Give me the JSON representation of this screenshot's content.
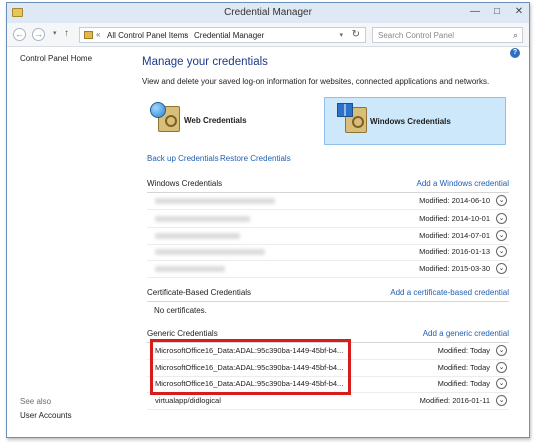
{
  "window": {
    "title": "Credential Manager",
    "controls": [
      "—",
      "□",
      "✕"
    ]
  },
  "nav": {
    "back_glyph": "←",
    "forward_glyph": "→",
    "dropdown_glyph": "▾",
    "up_glyph": "↑",
    "breadcrumb_arrows": "«",
    "breadcrumb": [
      "All Control Panel Items",
      "Credential Manager"
    ],
    "breadcrumb_sep": "›",
    "refresh_glyph": "↻",
    "search_placeholder": "Search Control Panel",
    "search_icon_glyph": "⌕"
  },
  "help_glyph": "?",
  "sidebar": {
    "home": "Control Panel Home",
    "see_also_label": "See also",
    "see_also_links": [
      "User Accounts"
    ]
  },
  "main": {
    "title": "Manage your credentials",
    "subtitle": "View and delete your saved log-on information for websites, connected applications and networks.",
    "tabs": [
      {
        "label": "Web Credentials",
        "selected": false
      },
      {
        "label": "Windows Credentials",
        "selected": true
      }
    ],
    "backup": "Back up Credentials",
    "restore": "Restore Credentials"
  },
  "windows_credentials": {
    "title": "Windows Credentials",
    "add": "Add a Windows credential",
    "rows": [
      {
        "name": "",
        "modified": "Modified:  2014-06-10"
      },
      {
        "name": "",
        "modified": "Modified:  2014-10-01"
      },
      {
        "name": "",
        "modified": "Modified:  2014-07-01"
      },
      {
        "name": "",
        "modified": "Modified:  2016-01-13"
      },
      {
        "name": "",
        "modified": "Modified:  2015-03-30"
      }
    ]
  },
  "certificate_credentials": {
    "title": "Certificate-Based Credentials",
    "add": "Add a certificate-based credential",
    "empty": "No certificates."
  },
  "generic_credentials": {
    "title": "Generic Credentials",
    "add": "Add a generic credential",
    "rows": [
      {
        "name": "MicrosoftOffice16_Data:ADAL:95c390ba-1449-45bf-b4...",
        "modified": "Modified:  Today"
      },
      {
        "name": "MicrosoftOffice16_Data:ADAL:95c390ba-1449-45bf-b4...",
        "modified": "Modified:  Today"
      },
      {
        "name": "MicrosoftOffice16_Data:ADAL:95c390ba-1449-45bf-b4...",
        "modified": "Modified:  Today"
      },
      {
        "name": "virtualapp/didlogical",
        "modified": "Modified:  2016-01-11"
      }
    ]
  },
  "expand_glyph": "⌄",
  "colors": {
    "accent_link": "#1f5fb3",
    "title_blue": "#1e3a8a",
    "selected_tab_bg": "#cde8fb",
    "highlight_red": "#d81b1b"
  }
}
